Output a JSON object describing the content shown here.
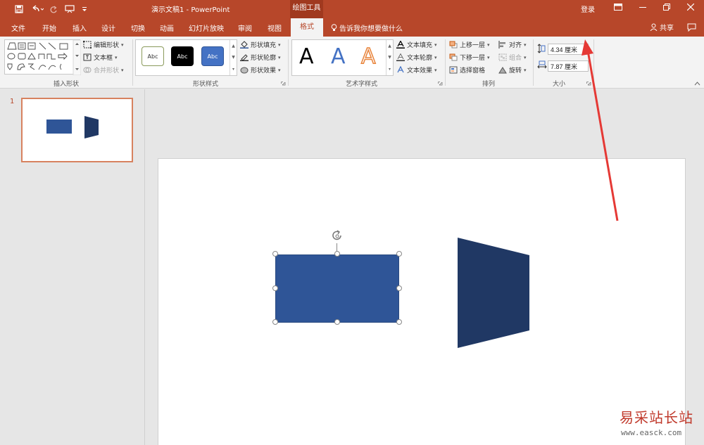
{
  "title_bar": {
    "document_title": "演示文稿1  -  PowerPoint",
    "contextual_tab": "绘图工具",
    "login": "登录",
    "quick_access_icons": [
      "save-icon",
      "undo-icon",
      "redo-icon",
      "customize-icon"
    ],
    "window_icons": [
      "ribbon-display-icon",
      "minimize-icon",
      "restore-icon",
      "close-icon"
    ]
  },
  "tabs": {
    "items": [
      "文件",
      "开始",
      "插入",
      "设计",
      "切换",
      "动画",
      "幻灯片放映",
      "审阅",
      "视图",
      "格式"
    ],
    "active": "格式",
    "tell_me": "告诉我你想要做什么",
    "share": "共享"
  },
  "ribbon": {
    "insert_shapes": {
      "label": "插入形状",
      "edit_shape": "编辑形状",
      "text_box": "文本框",
      "merge_shapes": "合并形状"
    },
    "shape_styles": {
      "label": "形状样式",
      "swatches": [
        "Abc",
        "Abc",
        "Abc"
      ],
      "fill": "形状填充",
      "outline": "形状轮廓",
      "effects": "形状效果"
    },
    "wordart_styles": {
      "label": "艺术字样式",
      "letters": [
        "A",
        "A",
        "A"
      ],
      "text_fill": "文本填充",
      "text_outline": "文本轮廓",
      "text_effects": "文本效果"
    },
    "arrange": {
      "label": "排列",
      "bring_forward": "上移一层",
      "send_backward": "下移一层",
      "selection_pane": "选择窗格",
      "align": "对齐",
      "group": "组合",
      "rotate": "旋转"
    },
    "size": {
      "label": "大小",
      "height": "4.34 厘米",
      "width": "7.87 厘米"
    }
  },
  "slides_panel": {
    "slide_number": "1"
  },
  "colors": {
    "accent": "#b7472a",
    "rect_fill": "#2f5597",
    "trapezoid_fill": "#203864",
    "annotation_arrow": "#e53935"
  },
  "watermark": {
    "chinese": "易采站长站",
    "url": "www.easck.com"
  }
}
